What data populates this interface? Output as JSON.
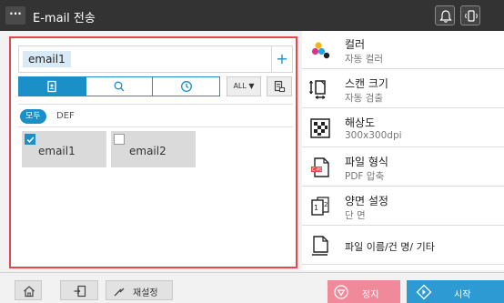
{
  "window": {
    "menu_label": "···",
    "title": "E-mail 전송",
    "icons": [
      "bell-icon",
      "mobile-nfc-icon"
    ]
  },
  "destination": {
    "chip": "email1",
    "add_label": "+",
    "tabs": [
      {
        "icon": "address-book-icon",
        "active": true
      },
      {
        "icon": "search-icon",
        "active": false
      },
      {
        "icon": "history-clock-icon",
        "active": false
      }
    ],
    "all_label": "ALL ▼",
    "filters": {
      "all": "모두",
      "index": "DEF"
    },
    "entries": [
      {
        "name": "email1",
        "checked": true
      },
      {
        "name": "email2",
        "checked": false
      }
    ]
  },
  "settings": [
    {
      "icon": "color-icon",
      "title": "컬러",
      "value": "자동 컬러"
    },
    {
      "icon": "scan-size-icon",
      "title": "스캔 크기",
      "value": "자동 검출"
    },
    {
      "icon": "resolution-icon",
      "title": "해상도",
      "value": "300x300dpi"
    },
    {
      "icon": "pdf-file-icon",
      "title": "파일 형식",
      "value": "PDF 압축"
    },
    {
      "icon": "duplex-icon",
      "title": "양면 설정",
      "value": "단 면"
    },
    {
      "icon": "document-icon",
      "title": "파일 이름/건 명/ 기타",
      "value": ""
    }
  ],
  "bottom": {
    "reset_label": "재설정",
    "stop_label": "정지",
    "start_label": "시작"
  },
  "colors": {
    "accent": "#1a8fc8",
    "highlight_border": "#e5474f",
    "stop": "#f08a9a",
    "start": "#2d9ad4"
  }
}
